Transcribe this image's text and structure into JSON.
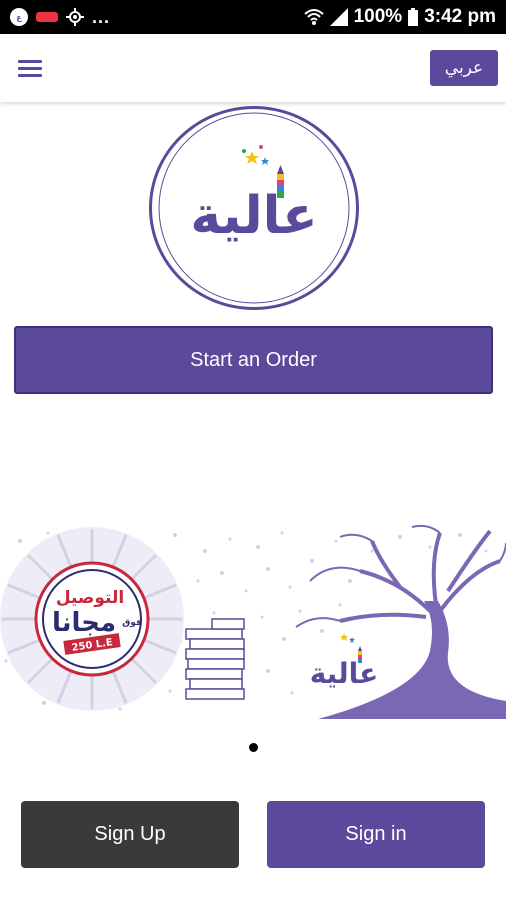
{
  "status_bar": {
    "left_dots": "...",
    "battery": "100%",
    "time": "3:42 pm"
  },
  "header": {
    "menu_icon": "hamburger-menu-icon",
    "language_button": "عربي"
  },
  "logo": {
    "brand_text": "عالية"
  },
  "actions": {
    "start_order": "Start an Order",
    "sign_up": "Sign Up",
    "sign_in": "Sign in"
  },
  "banner": {
    "badge_line1": "التوصيل",
    "badge_line2": "مجانا",
    "badge_above": "فوق",
    "badge_amount": "250 L.E",
    "brand_text": "عالية"
  },
  "pager": {
    "current": 1,
    "total": 1
  },
  "colors": {
    "primary": "#5b4a9b",
    "dark_button": "#3a3a3a",
    "badge_red": "#c8283c",
    "badge_navy": "#2b2d6e"
  }
}
